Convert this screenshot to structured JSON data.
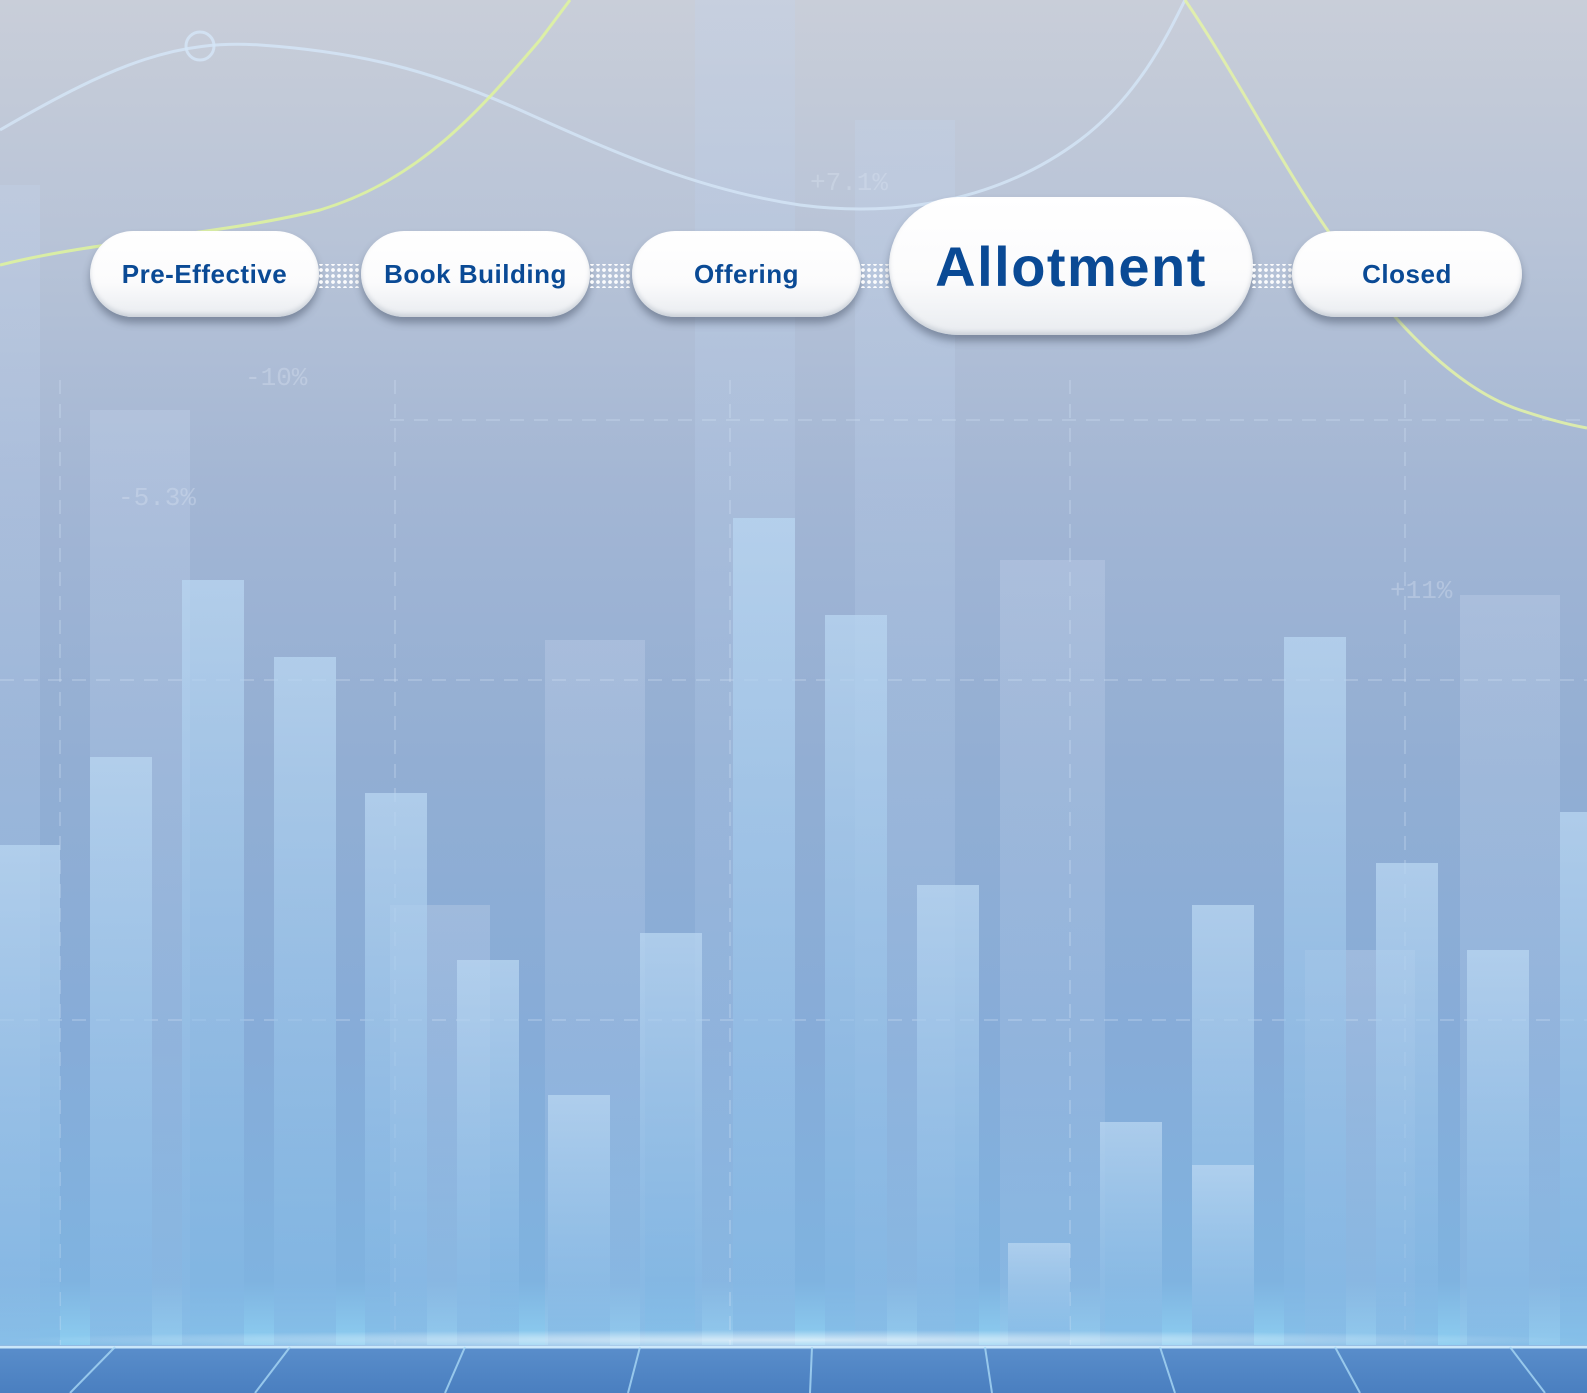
{
  "process_stepper": {
    "stages": [
      {
        "label": "Pre-Effective",
        "state": "inactive"
      },
      {
        "label": "Book Building",
        "state": "inactive"
      },
      {
        "label": "Offering",
        "state": "inactive"
      },
      {
        "label": "Allotment",
        "state": "active"
      },
      {
        "label": "Closed",
        "state": "inactive"
      }
    ],
    "active_index": 3
  },
  "background_percent_labels": [
    "-10%",
    "-5.3%",
    "+11%",
    "+7.1%"
  ],
  "colors": {
    "stage_text": "#0a4a95",
    "stage_fill": "#ffffff",
    "background_top": "#c9ced9",
    "background_bottom": "#7fb3e0",
    "bar_fill": "#9fc8ec",
    "accent_line_green": "#d9f29a",
    "accent_line_blue": "#cfe3f7"
  }
}
